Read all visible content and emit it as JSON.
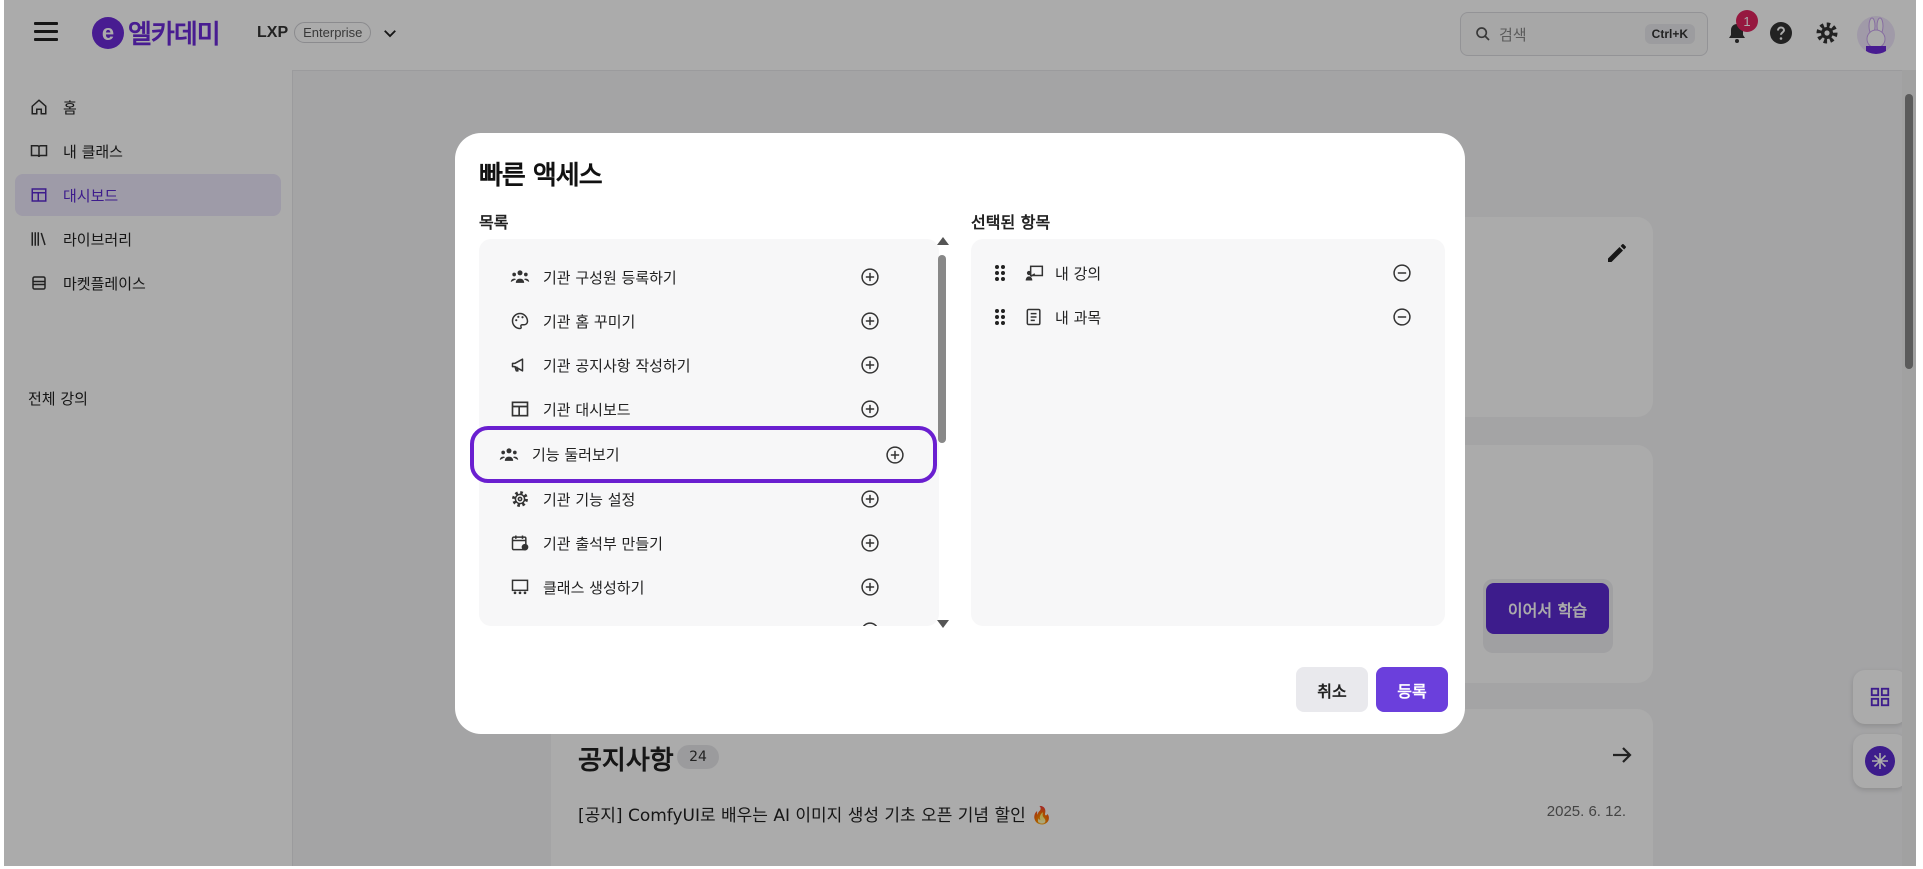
{
  "header": {
    "brand": "엘카데미",
    "logo_mark": "e",
    "product": "LXP",
    "edition": "Enterprise",
    "search_placeholder": "검색",
    "search_shortcut": "Ctrl+K",
    "notification_count": "1"
  },
  "sidebar": {
    "items": [
      {
        "label": "홈",
        "icon": "home-icon"
      },
      {
        "label": "내 클래스",
        "icon": "book-open-icon"
      },
      {
        "label": "대시보드",
        "icon": "dashboard-icon",
        "active": true
      },
      {
        "label": "라이브러리",
        "icon": "library-icon"
      },
      {
        "label": "마켓플레이스",
        "icon": "store-icon"
      }
    ],
    "all_courses": "전체 강의"
  },
  "main": {
    "continue_label": "이어서 학습",
    "notice_title": "공지사항",
    "notice_count": "24",
    "notices": [
      {
        "title": "[공지] ComfyUI로 배우는 AI 이미지 생성 기초 오픈 기념 할인 🔥",
        "date": "2025. 6. 12."
      }
    ]
  },
  "modal": {
    "title": "빠른 액세스",
    "list_label": "목록",
    "selected_label": "선택된 항목",
    "list_items": [
      {
        "label": "기관 구성원 등록하기",
        "icon": "users-icon"
      },
      {
        "label": "기관 홈 꾸미기",
        "icon": "palette-icon"
      },
      {
        "label": "기관 공지사항 작성하기",
        "icon": "megaphone-icon"
      },
      {
        "label": "기관 대시보드",
        "icon": "dashboard-icon"
      },
      {
        "label": "기능 둘러보기",
        "icon": "users-icon",
        "highlighted": true
      },
      {
        "label": "기관 기능 설정",
        "icon": "gear-icon"
      },
      {
        "label": "기관 출석부 만들기",
        "icon": "calendar-icon"
      },
      {
        "label": "클래스 생성하기",
        "icon": "classroom-icon"
      }
    ],
    "selected_items": [
      {
        "label": "내 강의",
        "icon": "teacher-icon"
      },
      {
        "label": "내 과목",
        "icon": "notebook-icon"
      }
    ],
    "cancel_label": "취소",
    "submit_label": "등록"
  },
  "colors": {
    "brand": "#6c2bd9",
    "primary_button": "#6b3fdc",
    "highlight_border": "#6a1fd0",
    "badge": "#e0245e"
  }
}
